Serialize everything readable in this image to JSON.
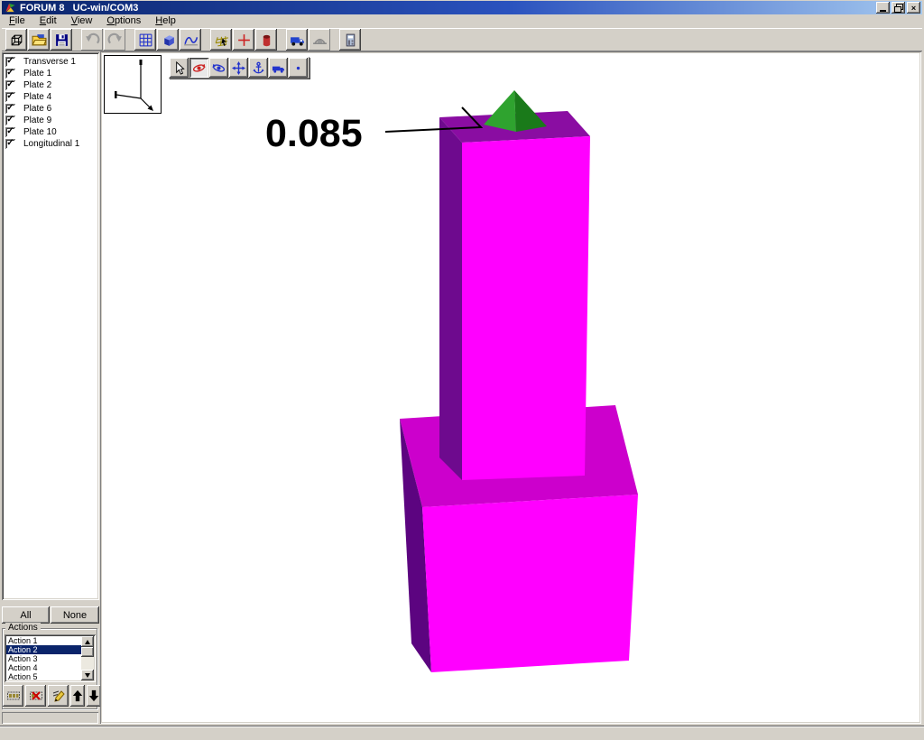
{
  "window": {
    "title": "FORUM 8   UC-win/COM3",
    "controls": [
      "minimize-icon",
      "restore-icon",
      "close-icon"
    ]
  },
  "menu": {
    "items": [
      {
        "label": "File"
      },
      {
        "label": "Edit"
      },
      {
        "label": "View"
      },
      {
        "label": "Options"
      },
      {
        "label": "Help"
      }
    ]
  },
  "toolbar": {
    "buttons": [
      {
        "icon": "wireframe-cube-icon",
        "disabled": false
      },
      {
        "icon": "open-folder-icon",
        "disabled": false
      },
      {
        "icon": "save-icon",
        "disabled": false
      },
      {
        "icon": "undo-icon",
        "disabled": true
      },
      {
        "icon": "redo-icon",
        "disabled": true
      },
      {
        "icon": "grid-icon",
        "disabled": false
      },
      {
        "icon": "solid-cube-icon",
        "disabled": false
      },
      {
        "icon": "curve-icon",
        "disabled": false
      },
      {
        "icon": "mesh-icon",
        "disabled": false
      },
      {
        "icon": "crosshair-icon",
        "disabled": false
      },
      {
        "icon": "load-cylinder-icon",
        "disabled": false
      },
      {
        "icon": "truck-icon",
        "disabled": false
      },
      {
        "icon": "bridge-load-icon",
        "disabled": true
      },
      {
        "icon": "calculator-icon",
        "disabled": false
      }
    ]
  },
  "sidebar": {
    "plates": [
      {
        "label": "Transverse 1",
        "checked": true
      },
      {
        "label": "Plate 1",
        "checked": true
      },
      {
        "label": "Plate 2",
        "checked": true
      },
      {
        "label": "Plate 4",
        "checked": true
      },
      {
        "label": "Plate 6",
        "checked": true
      },
      {
        "label": "Plate 9",
        "checked": true
      },
      {
        "label": "Plate 10",
        "checked": true
      },
      {
        "label": "Longitudinal 1",
        "checked": true
      }
    ],
    "all_label": "All",
    "none_label": "None",
    "actions": {
      "title": "Actions",
      "items": [
        "Action 1",
        "Action 2",
        "Action 3",
        "Action 4",
        "Action 5"
      ],
      "selected": "Action 2",
      "selected_index": 1
    }
  },
  "viewport": {
    "toolbar": [
      {
        "icon": "select-cursor-icon",
        "active": false
      },
      {
        "icon": "orbit-red-icon",
        "active": true
      },
      {
        "icon": "orbit-blue-icon",
        "active": false
      },
      {
        "icon": "pan-icon",
        "active": false
      },
      {
        "icon": "anchor-icon",
        "active": false
      },
      {
        "icon": "drive-truck-icon",
        "active": false
      },
      {
        "icon": "point-icon",
        "active": false
      }
    ],
    "annotation": {
      "value": "0.085"
    }
  },
  "model": {
    "colors": {
      "pyramid_left": "#2FA32F",
      "pyramid_right": "#1A7A1A",
      "column_top": "#8A0DA2",
      "column_left": "#6E0A8E",
      "column_front": "#FF00FF",
      "base_top": "#CC00CC",
      "base_left": "#5C0480",
      "base_front": "#FF00FF",
      "leader": "#000000"
    }
  }
}
